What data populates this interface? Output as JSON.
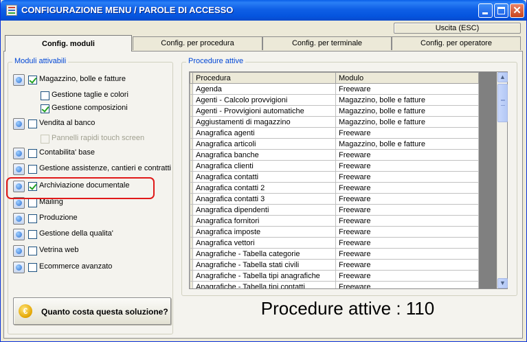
{
  "window": {
    "title": "CONFIGURAZIONE MENU / PAROLE DI ACCESSO"
  },
  "toolbar": {
    "exit_label": "Uscita (ESC)"
  },
  "tabs": [
    {
      "label": "Config. moduli",
      "active": true
    },
    {
      "label": "Config. per procedura",
      "active": false
    },
    {
      "label": "Config. per terminale",
      "active": false
    },
    {
      "label": "Config. per operatore",
      "active": false
    }
  ],
  "modules": {
    "legend": "Moduli attivabili",
    "items": [
      {
        "label": "Magazzino, bolle e fatture",
        "checked": true,
        "enabled": true
      },
      {
        "label": "Gestione taglie e colori",
        "checked": false,
        "enabled": true
      },
      {
        "label": "Gestione composizioni",
        "checked": true,
        "enabled": true
      },
      {
        "label": "Vendita al banco",
        "checked": false,
        "enabled": true
      },
      {
        "label": "Pannelli rapidi touch screen",
        "checked": false,
        "enabled": false
      },
      {
        "label": "Contabilita' base",
        "checked": false,
        "enabled": true
      },
      {
        "label": "Gestione assistenze, cantieri e contratti",
        "checked": false,
        "enabled": true
      },
      {
        "label": "Archiviazione documentale",
        "checked": true,
        "enabled": true
      },
      {
        "label": "Mailing",
        "checked": false,
        "enabled": true
      },
      {
        "label": "Produzione",
        "checked": false,
        "enabled": true
      },
      {
        "label": "Gestione della qualita'",
        "checked": false,
        "enabled": true
      },
      {
        "label": "Vetrina web",
        "checked": false,
        "enabled": true
      },
      {
        "label": "Ecommerce avanzato",
        "checked": false,
        "enabled": true
      }
    ]
  },
  "cost_button": {
    "icon": "euro-icon",
    "label": "Quanto costa questa soluzione?"
  },
  "procedures": {
    "legend": "Procedure attive",
    "columns": [
      "Procedura",
      "Modulo"
    ],
    "rows": [
      [
        "Agenda",
        "Freeware"
      ],
      [
        "Agenti - Calcolo provvigioni",
        "Magazzino, bolle e fatture"
      ],
      [
        "Agenti - Provvigioni automatiche",
        "Magazzino, bolle e fatture"
      ],
      [
        "Aggiustamenti di magazzino",
        "Magazzino, bolle e fatture"
      ],
      [
        "Anagrafica agenti",
        "Freeware"
      ],
      [
        "Anagrafica articoli",
        "Magazzino, bolle e fatture"
      ],
      [
        "Anagrafica banche",
        "Freeware"
      ],
      [
        "Anagrafica clienti",
        "Freeware"
      ],
      [
        "Anagrafica contatti",
        "Freeware"
      ],
      [
        "Anagrafica contatti 2",
        "Freeware"
      ],
      [
        "Anagrafica contatti 3",
        "Freeware"
      ],
      [
        "Anagrafica dipendenti",
        "Freeware"
      ],
      [
        "Anagrafica fornitori",
        "Freeware"
      ],
      [
        "Anagrafica imposte",
        "Freeware"
      ],
      [
        "Anagrafica vettori",
        "Freeware"
      ],
      [
        "Anagrafiche - Tabella categorie",
        "Freeware"
      ],
      [
        "Anagrafiche - Tabella stati civili",
        "Freeware"
      ],
      [
        "Anagrafiche - Tabella tipi anagrafiche",
        "Freeware"
      ],
      [
        "Anagrafiche - Tabella tipi contatti",
        "Freeware"
      ]
    ],
    "counter_text": "Procedure attive : 110"
  },
  "colors": {
    "title_bar": "#0554de",
    "legend_text": "#0046d5",
    "highlight": "#e01818",
    "check": "#21a121"
  }
}
